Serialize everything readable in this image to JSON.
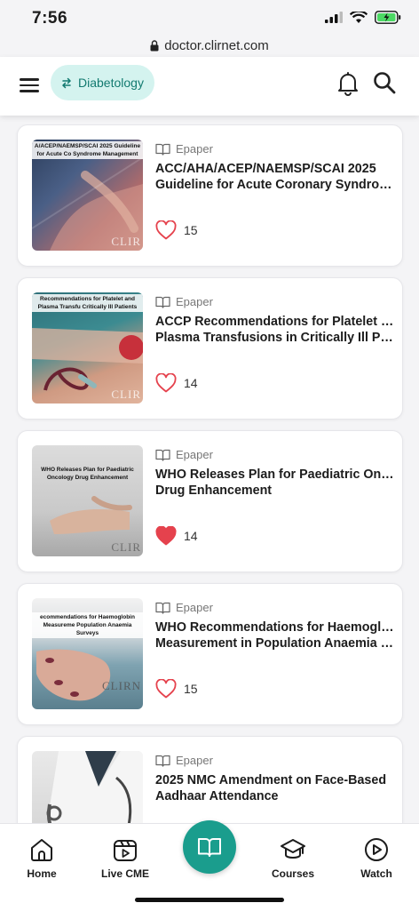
{
  "status_bar": {
    "time": "7:56"
  },
  "browser": {
    "url": "doctor.clirnet.com"
  },
  "header": {
    "specialty": "Diabetology",
    "brand_color": "#1a9d8d"
  },
  "feed": {
    "items": [
      {
        "category": "Epaper",
        "title_line1": "ACC/AHA/ACEP/NAEMSP/SCAI 2025",
        "title_line2": "Guideline for Acute Coronary Syndrome M...",
        "likes": "15",
        "liked": false,
        "thumb_caption": "A/ACEP/NAEMSP/SCAI 2025 Guideline for Acute Co Syndrome Management",
        "thumb_watermark": "CLIR"
      },
      {
        "category": "Epaper",
        "title_line1": "ACCP Recommendations for Platelet and",
        "title_line2": "Plasma Transfusions in Critically Ill Patients",
        "likes": "14",
        "liked": false,
        "thumb_caption": "Recommendations for Platelet and Plasma Transfu Critically Ill Patients",
        "thumb_watermark": "CLIR"
      },
      {
        "category": "Epaper",
        "title_line1": "WHO Releases Plan for Paediatric Oncology",
        "title_line2": "Drug Enhancement",
        "likes": "14",
        "liked": true,
        "thumb_caption": "WHO Releases Plan for Paediatric Oncology Drug Enhancement",
        "thumb_watermark": "CLIR"
      },
      {
        "category": "Epaper",
        "title_line1": "WHO Recommendations for Haemoglobin",
        "title_line2": "Measurement in Population Anaemia Surv...",
        "likes": "15",
        "liked": false,
        "thumb_caption": "ecommendations for Haemoglobin Measureme Population Anaemia Surveys",
        "thumb_watermark": "CLIRN"
      },
      {
        "category": "Epaper",
        "title_line1": "2025 NMC Amendment on Face-Based",
        "title_line2": "Aadhaar Attendance",
        "likes": "",
        "liked": false,
        "thumb_caption": "",
        "thumb_watermark": ""
      }
    ]
  },
  "bottom_nav": {
    "home": "Home",
    "live_cme": "Live CME",
    "courses": "Courses",
    "watch": "Watch"
  },
  "icons": {
    "menu": "hamburger-menu-icon",
    "bell": "bell-icon",
    "search": "search-icon",
    "swap": "swap-arrows-icon",
    "epaper": "book-open-icon",
    "heart": "heart-icon",
    "home": "home-icon",
    "live": "live-cme-icon",
    "fab": "book-open-icon",
    "courses": "graduation-cap-icon",
    "watch": "play-circle-icon"
  }
}
